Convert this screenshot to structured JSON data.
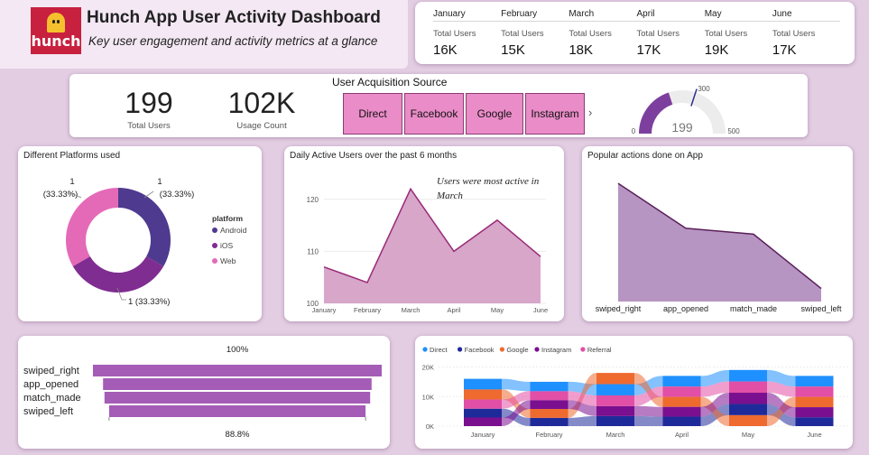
{
  "header": {
    "logo_text": "hunch",
    "title": "Hunch App User Activity Dashboard",
    "subtitle": "Key user engagement and activity metrics at a glance"
  },
  "months": [
    {
      "name": "January",
      "caption": "Total Users",
      "value": "16K"
    },
    {
      "name": "February",
      "caption": "Total Users",
      "value": "15K"
    },
    {
      "name": "March",
      "caption": "Total Users",
      "value": "18K"
    },
    {
      "name": "April",
      "caption": "Total Users",
      "value": "17K"
    },
    {
      "name": "May",
      "caption": "Total Users",
      "value": "19K"
    },
    {
      "name": "June",
      "caption": "Total Users",
      "value": "17K"
    }
  ],
  "kpis": {
    "users_value": "199",
    "users_caption": "Total Users",
    "usage_value": "102K",
    "usage_caption": "Usage Count"
  },
  "acquisition": {
    "title": "User Acquisition Source",
    "sources": [
      "Direct",
      "Facebook",
      "Google",
      "Instagram"
    ],
    "next_icon": "chevron-right-icon"
  },
  "gauge": {
    "value": 199,
    "value_label": "199",
    "min_label": "0",
    "max_label": "500",
    "target_label": "300",
    "min": 0,
    "max": 500,
    "target": 300
  },
  "platforms": {
    "title": "Different Platforms used",
    "legend_title": "platform",
    "items": [
      {
        "name": "Android",
        "value": 1,
        "label": "1",
        "pct": "(33.33%)",
        "color": "#4e3a8f"
      },
      {
        "name": "iOS",
        "value": 1,
        "label": "1 (33.33%)",
        "color": "#7f2d91"
      },
      {
        "name": "Web",
        "value": 1,
        "label": "1",
        "pct": "(33.33%)",
        "color": "#e46ab8"
      }
    ]
  },
  "dau": {
    "title": "Daily Active Users over the past 6 months",
    "annotation_line1": "Users were most active in",
    "annotation_line2": "March"
  },
  "popular": {
    "title": "Popular actions done on App"
  },
  "funnel": {
    "top_label": "100%",
    "bottom_label": "88.8%"
  },
  "ribbon": {
    "legend": [
      {
        "name": "Direct",
        "color": "#1e90ff"
      },
      {
        "name": "Facebook",
        "color": "#1f2a9a"
      },
      {
        "name": "Google",
        "color": "#ee6a2f"
      },
      {
        "name": "Instagram",
        "color": "#7a0f8f"
      },
      {
        "name": "Referral",
        "color": "#e14fa6"
      }
    ]
  },
  "chart_data": [
    {
      "type": "pie",
      "title": "Different Platforms used",
      "categories": [
        "Android",
        "iOS",
        "Web"
      ],
      "values": [
        1,
        1,
        1
      ]
    },
    {
      "type": "area",
      "title": "Daily Active Users over the past 6 months",
      "categories": [
        "January",
        "February",
        "March",
        "April",
        "May",
        "June"
      ],
      "values": [
        107,
        104,
        122,
        110,
        116,
        109
      ],
      "ylim": [
        100,
        125
      ],
      "yticks": [
        "100",
        "110",
        "120"
      ]
    },
    {
      "type": "area",
      "title": "Popular actions done on App",
      "categories": [
        "swiped_right",
        "app_opened",
        "match_made",
        "swiped_left"
      ],
      "values": [
        100,
        62,
        57,
        11
      ],
      "ylim": [
        0,
        110
      ]
    },
    {
      "type": "bar",
      "categories": [
        "swiped_right",
        "app_opened",
        "match_made",
        "swiped_left"
      ],
      "values": [
        100,
        93,
        92,
        88.8
      ]
    },
    {
      "type": "bar",
      "categories": [
        "January",
        "February",
        "March",
        "April",
        "May",
        "June"
      ],
      "yticks": [
        "0K",
        "10K",
        "20K"
      ],
      "ylim": [
        0,
        22000
      ],
      "series": [
        {
          "name": "Direct",
          "values": [
            3600,
            3200,
            3800,
            3600,
            3900,
            3600
          ]
        },
        {
          "name": "Facebook",
          "values": [
            3000,
            2800,
            3400,
            3200,
            3800,
            3000
          ]
        },
        {
          "name": "Google",
          "values": [
            3400,
            3000,
            3800,
            3400,
            3700,
            3500
          ]
        },
        {
          "name": "Instagram",
          "values": [
            2900,
            3000,
            3400,
            3300,
            3800,
            3400
          ]
        },
        {
          "name": "Referral",
          "values": [
            3100,
            3000,
            3600,
            3500,
            3800,
            3500
          ]
        }
      ]
    }
  ]
}
